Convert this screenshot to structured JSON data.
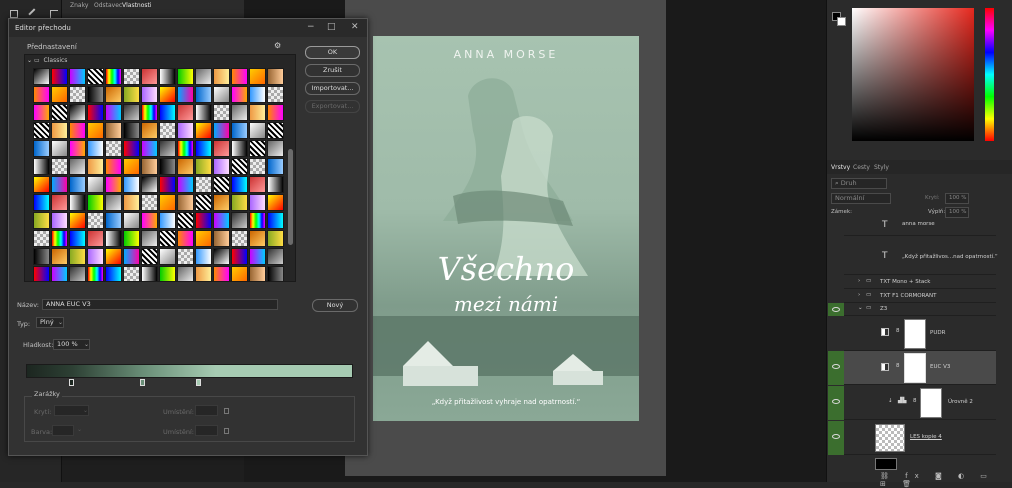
{
  "props_tabs": [
    "Znaky",
    "Odstavec",
    "Vlastnosti"
  ],
  "cover": {
    "author": "ANNA MORSE",
    "title": "Všechno",
    "subtitle": "mezi námi",
    "tagline": "„Když přitažlivost vyhraje nad opatrností.“"
  },
  "layers_panel": {
    "tabs": [
      "Vrstvy",
      "Cesty",
      "Styly"
    ],
    "search_placeholder": "Druh",
    "blend_mode": "Normální",
    "opacity_label": "Krytí:",
    "opacity_value": "100 %",
    "lock_label": "Zámek:",
    "fill_label": "Výplň:",
    "fill_value": "100 %",
    "layers": [
      {
        "name": "anna morse"
      },
      {
        "name": "„Když přitažlivos...nad opatrností.“"
      },
      {
        "name": "TXT Mono + Stack"
      },
      {
        "name": "TXT F1 CORMORANT"
      },
      {
        "name": "Z3"
      },
      {
        "name": "PUDR"
      },
      {
        "name": "EUC V3"
      },
      {
        "name": "Úrovně 2"
      },
      {
        "name": "LES kopie 4"
      }
    ]
  },
  "dialog": {
    "title": "Editor přechodu",
    "presets_label": "Přednastavení",
    "folder_name": "Classics",
    "buttons": {
      "ok": "OK",
      "cancel": "Zrušit",
      "import": "Importovat...",
      "export": "Exportovat...",
      "new": "Nový"
    },
    "name_label": "Název:",
    "name_value": "ANNA EUC V3",
    "type_label": "Typ:",
    "type_value": "Plný",
    "smoothness_label": "Hladkost:",
    "smoothness_value": "100 %",
    "stops_label": "Zarážky",
    "opacity_label": "Krytí:",
    "location_label_1": "Umístění:",
    "color_label": "Barva:",
    "location_label_2": "Umístění:"
  }
}
